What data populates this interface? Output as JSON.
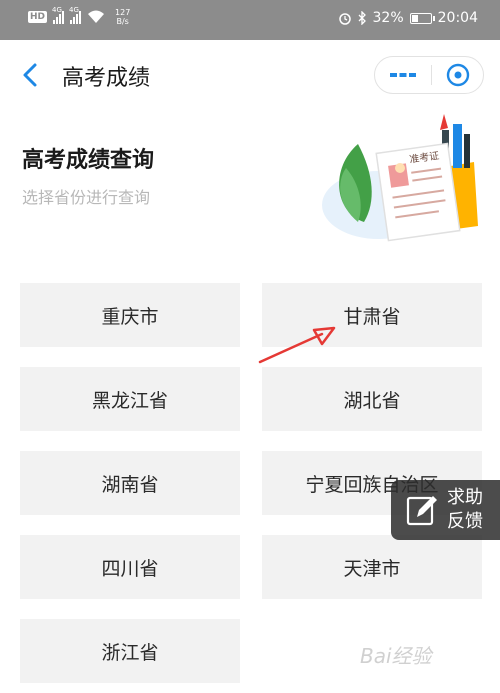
{
  "status_bar": {
    "hd_label": "HD",
    "signal_label": "4G",
    "speed_value": "127",
    "speed_unit": "B/s",
    "battery": "32%",
    "battery_level": 0.32,
    "time": "20:04"
  },
  "header": {
    "title": "高考成绩",
    "icons": [
      "back-chevron-icon",
      "more-dots-icon",
      "close-target-icon"
    ],
    "accent": "#1e88e5"
  },
  "banner": {
    "title": "高考成绩查询",
    "subtitle": "选择省份进行查询",
    "card_text": "准考证"
  },
  "provinces": [
    "重庆市",
    "甘肃省",
    "黑龙江省",
    "湖北省",
    "湖南省",
    "宁夏回族自治区",
    "四川省",
    "天津市",
    "浙江省"
  ],
  "help_button": {
    "line1": "求助",
    "line2": "反馈"
  },
  "watermark": "Bai经验",
  "colors": {
    "cell_bg": "#f2f2f2",
    "status_bg": "#8c8c8c",
    "annotation_arrow": "#e53935"
  }
}
